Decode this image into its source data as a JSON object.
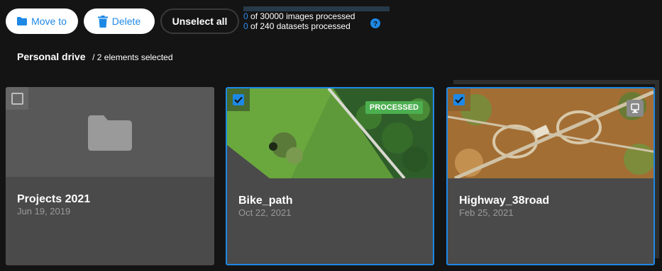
{
  "toolbar": {
    "move_label": "Move to",
    "delete_label": "Delete",
    "unselect_label": "Unselect all"
  },
  "progress": {
    "images_count": "0",
    "images_text": " of 30000 images processed",
    "datasets_count": "0",
    "datasets_text": " of 240 datasets processed",
    "images_fraction": 0.0,
    "datasets_fraction": 0.0
  },
  "breadcrumb": {
    "drive": "Personal drive",
    "selection": "/ 2 elements selected"
  },
  "cards": [
    {
      "title": "Projects 2021",
      "date": "Jun 19, 2019",
      "type": "folder",
      "selected": false
    },
    {
      "title": "Bike_path",
      "date": "Oct 22, 2021",
      "type": "dataset",
      "selected": true,
      "badge": "PROCESSED"
    },
    {
      "title": "Highway_38road",
      "date": "Feb 25, 2021",
      "type": "dataset",
      "selected": true
    }
  ],
  "colors": {
    "accent": "#1e88e5",
    "processed": "#4caf50",
    "background": "#141414",
    "card": "#4a4a4a"
  },
  "icons": [
    "folder-icon",
    "trash-icon",
    "help-icon",
    "check-icon",
    "device-icon"
  ]
}
